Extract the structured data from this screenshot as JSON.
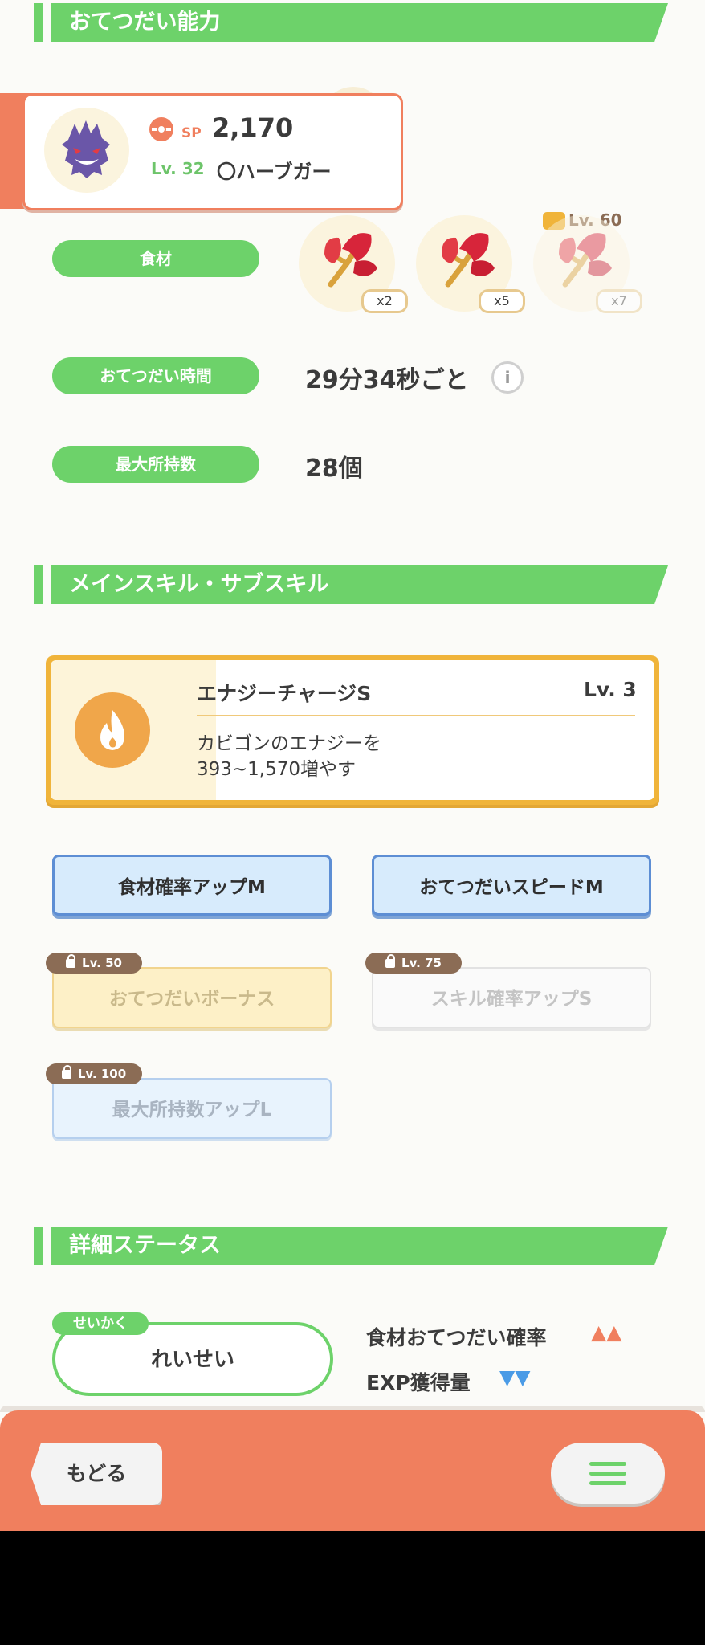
{
  "sections": {
    "ability": "おてつだい能力",
    "skills": "メインスキル・サブスキル",
    "status": "詳細ステータス"
  },
  "pokemon_card": {
    "sp_label": "SP",
    "sp_value": "2,170",
    "level": "Lv. 32",
    "name": "〇ハーブガー"
  },
  "ingredients": {
    "label": "食材",
    "unlock_level": "Lv. 60",
    "items": [
      {
        "icon": "fiery-herb-icon",
        "qty": "x2"
      },
      {
        "icon": "fiery-herb-icon",
        "qty": "x5"
      },
      {
        "icon": "fiery-herb-icon",
        "qty": "x7"
      }
    ]
  },
  "help_time": {
    "label": "おてつだい時間",
    "value": "29分34秒ごと"
  },
  "max_carry": {
    "label": "最大所持数",
    "value": "28個"
  },
  "main_skill": {
    "name": "エナジーチャージS",
    "level": "Lv. 3",
    "desc_line1": "カビゴンのエナジーを",
    "desc_line2": "393~1,570増やす",
    "icon": "fire-icon"
  },
  "sub_skills": [
    {
      "label": "食材確率アップM"
    },
    {
      "label": "おてつだいスピードM"
    },
    {
      "label": "おてつだいボーナス",
      "unlock": "Lv. 50"
    },
    {
      "label": "スキル確率アップS",
      "unlock": "Lv. 75"
    },
    {
      "label": "最大所持数アップL",
      "unlock": "Lv. 100"
    }
  ],
  "nature": {
    "tag": "せいかく",
    "value": "れいせい",
    "up_label": "食材おてつだい確率",
    "up_marks": "▲▲",
    "down_label": "EXP獲得量",
    "down_marks": "▼▼"
  },
  "footer": {
    "back_label": "もどる",
    "menu_icon": "hamburger-menu-icon"
  },
  "colors": {
    "green": "#6dd26a",
    "orange": "#f07f5e",
    "gold": "#f0b43a"
  }
}
